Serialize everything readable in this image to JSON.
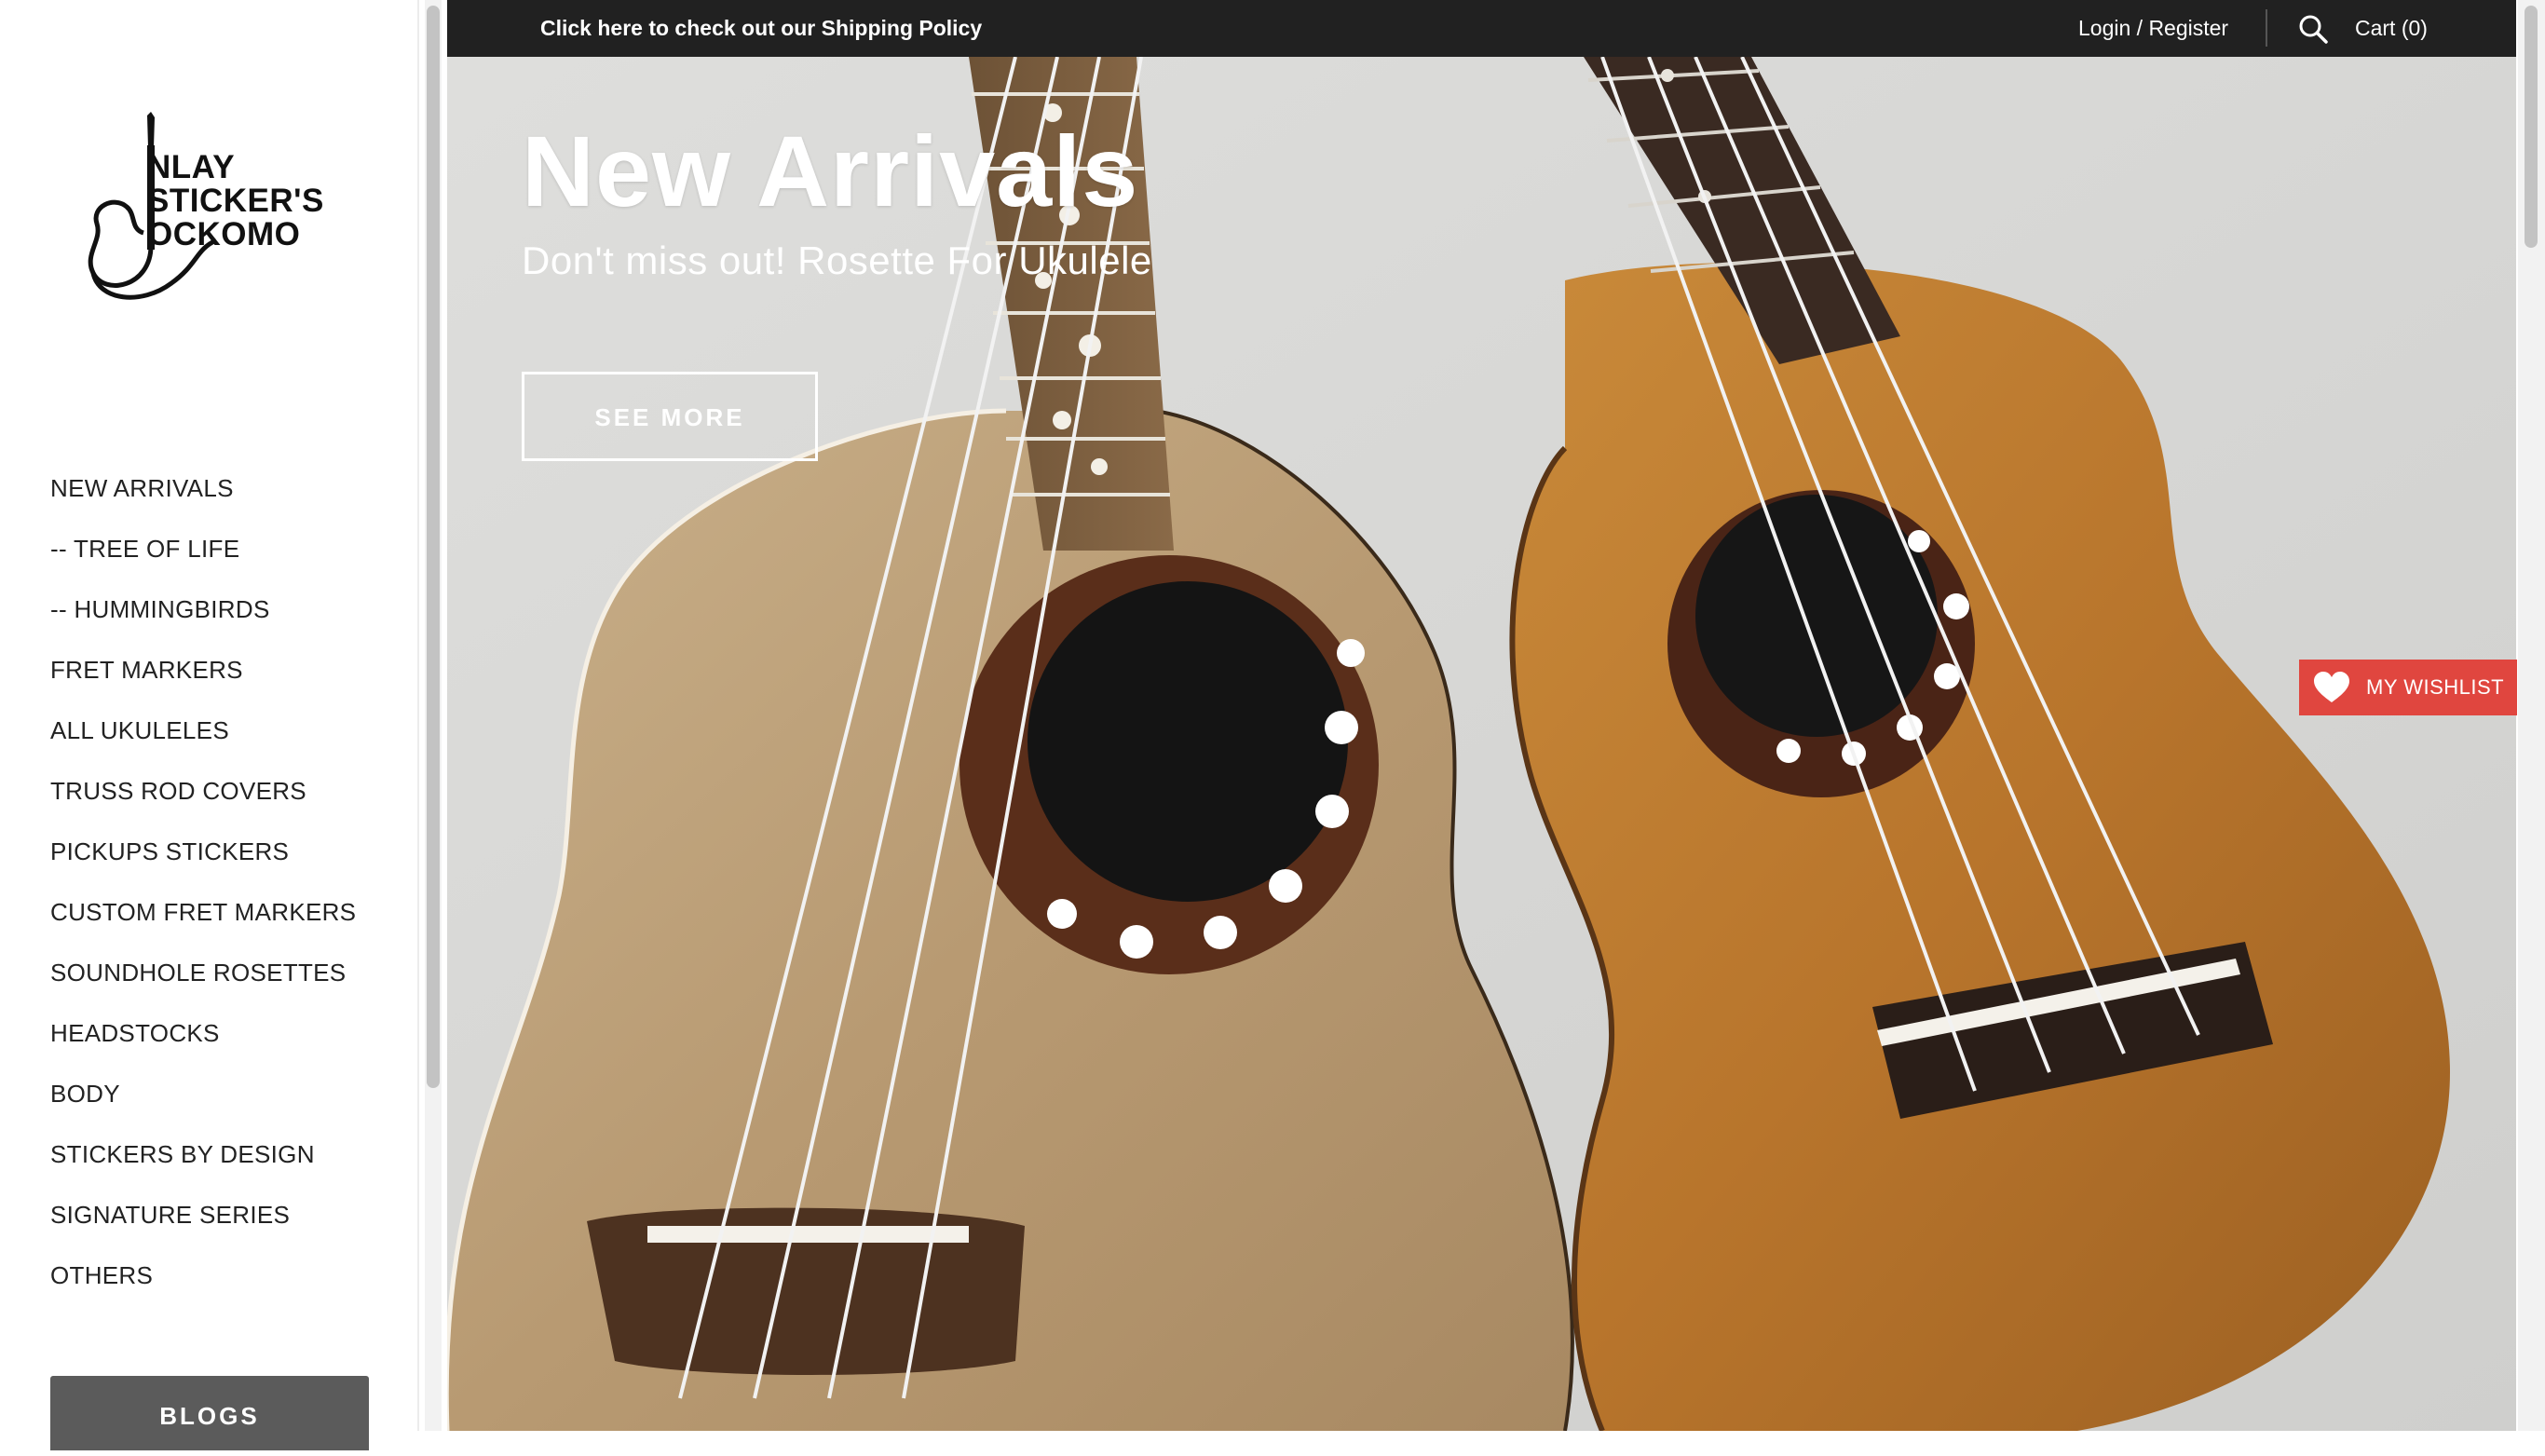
{
  "topbar": {
    "policy_link": "Click here to check out our Shipping Policy",
    "login_register": "Login / Register",
    "cart": "Cart (0)",
    "search_icon": "search-icon"
  },
  "logo": {
    "line1": "NLAY",
    "line2": "STICKER'S",
    "line3": "OCKOMO"
  },
  "sidebar": {
    "items": [
      {
        "label": "NEW ARRIVALS"
      },
      {
        "label": "-- TREE OF LIFE"
      },
      {
        "label": "-- HUMMINGBIRDS"
      },
      {
        "label": "FRET MARKERS"
      },
      {
        "label": "ALL UKULELES"
      },
      {
        "label": "TRUSS ROD COVERS"
      },
      {
        "label": "PICKUPS STICKERS"
      },
      {
        "label": "CUSTOM FRET MARKERS"
      },
      {
        "label": "SOUNDHOLE ROSETTES"
      },
      {
        "label": "HEADSTOCKS"
      },
      {
        "label": "BODY"
      },
      {
        "label": "STICKERS BY DESIGN"
      },
      {
        "label": "SIGNATURE SERIES"
      },
      {
        "label": "OTHERS"
      }
    ],
    "blogs_button": "BLOGS"
  },
  "hero": {
    "title": "New Arrivals",
    "subtitle": "Don't miss out! Rosette For Ukulele",
    "button": "SEE MORE"
  },
  "wishlist": {
    "label": "MY WISHLIST",
    "icon": "heart-icon",
    "color": "#e0463f"
  },
  "colors": {
    "topbar_bg": "#212121",
    "blogs_bg": "#5b5b5b",
    "wishlist_bg": "#e0463f"
  }
}
